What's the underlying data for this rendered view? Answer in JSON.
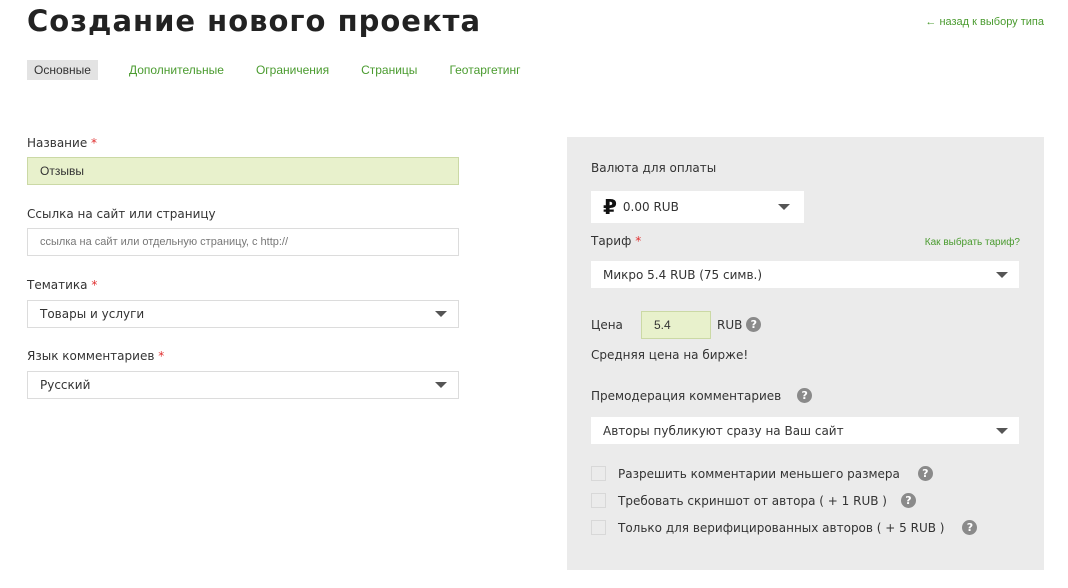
{
  "header": {
    "title": "Создание нового проекта",
    "back_link": "← назад к выбору типа"
  },
  "tabs": [
    {
      "label": "Основные",
      "active": true
    },
    {
      "label": "Дополнительные"
    },
    {
      "label": "Ограничения"
    },
    {
      "label": "Страницы"
    },
    {
      "label": "Геотаргетинг"
    }
  ],
  "form": {
    "name": {
      "label": "Название",
      "required_mark": "*",
      "value": "Отзывы"
    },
    "link": {
      "label": "Ссылка на сайт или страницу",
      "placeholder": "ссылка на сайт или отдельную страницу, с http://"
    },
    "topic": {
      "label": "Тематика",
      "required_mark": "*",
      "value": "Товары и услуги"
    },
    "language": {
      "label": "Язык комментариев",
      "required_mark": "*",
      "value": "Русский"
    }
  },
  "panel": {
    "currency": {
      "label": "Валюта для оплаты",
      "symbol": "₽",
      "value": "0.00 RUB"
    },
    "tariff": {
      "label": "Тариф",
      "required_mark": "*",
      "help_link": "Как выбрать тариф?",
      "value": "Микро 5.4 RUB (75 симв.)"
    },
    "price": {
      "label": "Цена",
      "value": "5.4",
      "unit": "RUB",
      "note": "Средняя цена на бирже!"
    },
    "premoderation": {
      "label": "Премодерация комментариев",
      "value": "Авторы публикуют сразу на Ваш сайт"
    },
    "options": [
      {
        "label": "Разрешить комментарии меньшего размера",
        "checked": false
      },
      {
        "label": "Требовать скриншот от автора ( + 1 RUB )",
        "checked": false
      },
      {
        "label": "Только для верифицированных авторов ( + 5 RUB )",
        "checked": false
      }
    ],
    "help_glyph": "?"
  },
  "colors": {
    "accent": "#4a9b2f",
    "required": "#e03030",
    "filled_bg": "#e8f1cc",
    "panel_bg": "#ebebeb"
  }
}
